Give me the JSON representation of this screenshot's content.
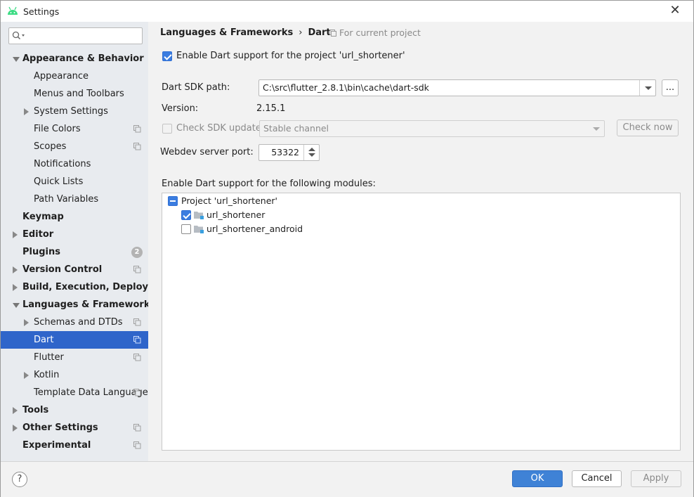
{
  "window": {
    "title": "Settings",
    "close_label": "✕"
  },
  "sidebar": {
    "search": {
      "value": "",
      "placeholder": ""
    },
    "items": [
      {
        "label": "Appearance & Behavior",
        "level": 0,
        "bold": true,
        "arrow": "down",
        "shared": false
      },
      {
        "label": "Appearance",
        "level": 1,
        "bold": false,
        "arrow": "none",
        "shared": false
      },
      {
        "label": "Menus and Toolbars",
        "level": 1,
        "bold": false,
        "arrow": "none",
        "shared": false
      },
      {
        "label": "System Settings",
        "level": 1,
        "bold": false,
        "arrow": "right",
        "shared": false
      },
      {
        "label": "File Colors",
        "level": 1,
        "bold": false,
        "arrow": "none",
        "shared": true
      },
      {
        "label": "Scopes",
        "level": 1,
        "bold": false,
        "arrow": "none",
        "shared": true
      },
      {
        "label": "Notifications",
        "level": 1,
        "bold": false,
        "arrow": "none",
        "shared": false
      },
      {
        "label": "Quick Lists",
        "level": 1,
        "bold": false,
        "arrow": "none",
        "shared": false
      },
      {
        "label": "Path Variables",
        "level": 1,
        "bold": false,
        "arrow": "none",
        "shared": false
      },
      {
        "label": "Keymap",
        "level": 0,
        "bold": true,
        "arrow": "none",
        "shared": false
      },
      {
        "label": "Editor",
        "level": 0,
        "bold": true,
        "arrow": "right",
        "shared": false
      },
      {
        "label": "Plugins",
        "level": 0,
        "bold": true,
        "arrow": "none",
        "shared": false,
        "badge": "2"
      },
      {
        "label": "Version Control",
        "level": 0,
        "bold": true,
        "arrow": "right",
        "shared": true
      },
      {
        "label": "Build, Execution, Deployment",
        "level": 0,
        "bold": true,
        "arrow": "right",
        "shared": false
      },
      {
        "label": "Languages & Frameworks",
        "level": 0,
        "bold": true,
        "arrow": "down",
        "shared": false
      },
      {
        "label": "Schemas and DTDs",
        "level": 1,
        "bold": false,
        "arrow": "right",
        "shared": true
      },
      {
        "label": "Dart",
        "level": 1,
        "bold": false,
        "arrow": "none",
        "shared": true,
        "selected": true
      },
      {
        "label": "Flutter",
        "level": 1,
        "bold": false,
        "arrow": "none",
        "shared": true
      },
      {
        "label": "Kotlin",
        "level": 1,
        "bold": false,
        "arrow": "right",
        "shared": false
      },
      {
        "label": "Template Data Languages",
        "level": 1,
        "bold": false,
        "arrow": "none",
        "shared": true
      },
      {
        "label": "Tools",
        "level": 0,
        "bold": true,
        "arrow": "right",
        "shared": false
      },
      {
        "label": "Other Settings",
        "level": 0,
        "bold": true,
        "arrow": "right",
        "shared": true
      },
      {
        "label": "Experimental",
        "level": 0,
        "bold": true,
        "arrow": "none",
        "shared": true
      }
    ]
  },
  "main": {
    "breadcrumb": {
      "parent": "Languages & Frameworks",
      "separator": "›",
      "current": "Dart"
    },
    "scope_note": "For current project",
    "enable_dart": {
      "label": "Enable Dart support for the project 'url_shortener'",
      "checked": true
    },
    "sdk_path": {
      "label": "Dart SDK path:",
      "value": "C:\\src\\flutter_2.8.1\\bin\\cache\\dart-sdk",
      "browse_label": "..."
    },
    "version": {
      "label": "Version:",
      "value": "2.15.1"
    },
    "check_update": {
      "label": "Check SDK update:",
      "channel": "Stable channel",
      "check_now_label": "Check now",
      "checked": false
    },
    "webdev_port": {
      "label": "Webdev server port:",
      "value": "53322"
    },
    "modules_label": "Enable Dart support for the following modules:",
    "modules": {
      "project": {
        "label": "Project 'url_shortener'",
        "state": "partial"
      },
      "items": [
        {
          "label": "url_shortener",
          "checked": true
        },
        {
          "label": "url_shortener_android",
          "checked": false
        }
      ]
    }
  },
  "footer": {
    "help_label": "?",
    "ok_label": "OK",
    "cancel_label": "Cancel",
    "apply_label": "Apply"
  },
  "colors": {
    "accent": "#3f82d6",
    "selection": "#2f65ca",
    "sidebar_bg": "#e8ebef",
    "android_green": "#3ddc84"
  }
}
